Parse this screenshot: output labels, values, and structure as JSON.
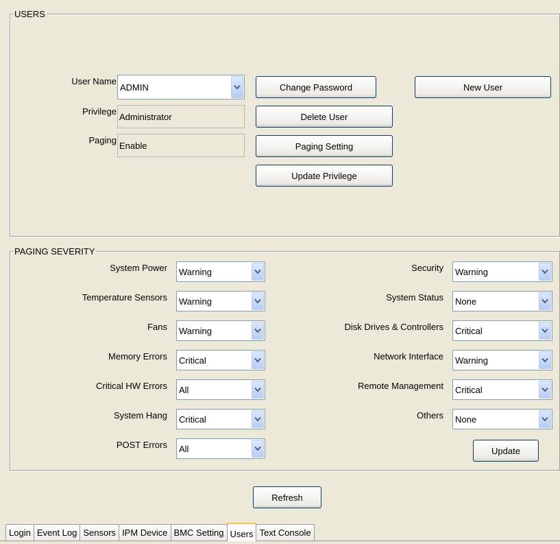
{
  "users": {
    "title": "USERS",
    "user_name_label": "User Name",
    "user_name_value": "ADMIN",
    "privilege_label": "Privilege",
    "privilege_value": "Administrator",
    "paging_label": "Paging",
    "paging_value": "Enable",
    "buttons": {
      "change_password": "Change Password",
      "new_user": "New User",
      "delete_user": "Delete User",
      "paging_setting": "Paging Setting",
      "update_privilege": "Update Privilege"
    }
  },
  "paging_severity": {
    "title": "PAGING SEVERITY",
    "left": [
      {
        "label": "System Power",
        "value": "Warning"
      },
      {
        "label": "Temperature Sensors",
        "value": "Warning"
      },
      {
        "label": "Fans",
        "value": "Warning"
      },
      {
        "label": "Memory Errors",
        "value": "Critical"
      },
      {
        "label": "Critical HW Errors",
        "value": "All"
      },
      {
        "label": "System Hang",
        "value": "Critical"
      },
      {
        "label": "POST Errors",
        "value": "All"
      }
    ],
    "right": [
      {
        "label": "Security",
        "value": "Warning"
      },
      {
        "label": "System Status",
        "value": "None"
      },
      {
        "label": "Disk Drives & Controllers",
        "value": "Critical"
      },
      {
        "label": "Network Interface",
        "value": "Warning"
      },
      {
        "label": "Remote Management",
        "value": "Critical"
      },
      {
        "label": "Others",
        "value": "None"
      }
    ],
    "update_label": "Update"
  },
  "refresh_label": "Refresh",
  "tabs": [
    {
      "label": "Login"
    },
    {
      "label": "Event Log"
    },
    {
      "label": "Sensors"
    },
    {
      "label": "IPM Device"
    },
    {
      "label": "BMC Setting"
    },
    {
      "label": "Users",
      "active": true
    },
    {
      "label": "Text Console"
    }
  ],
  "icons": {
    "dropdown": "chevron-down-icon"
  },
  "colors": {
    "background": "#ece9d8",
    "active_tab_accent": "#ffc83c",
    "button_border": "#003c74",
    "combo_arrow": "#4d6185"
  }
}
